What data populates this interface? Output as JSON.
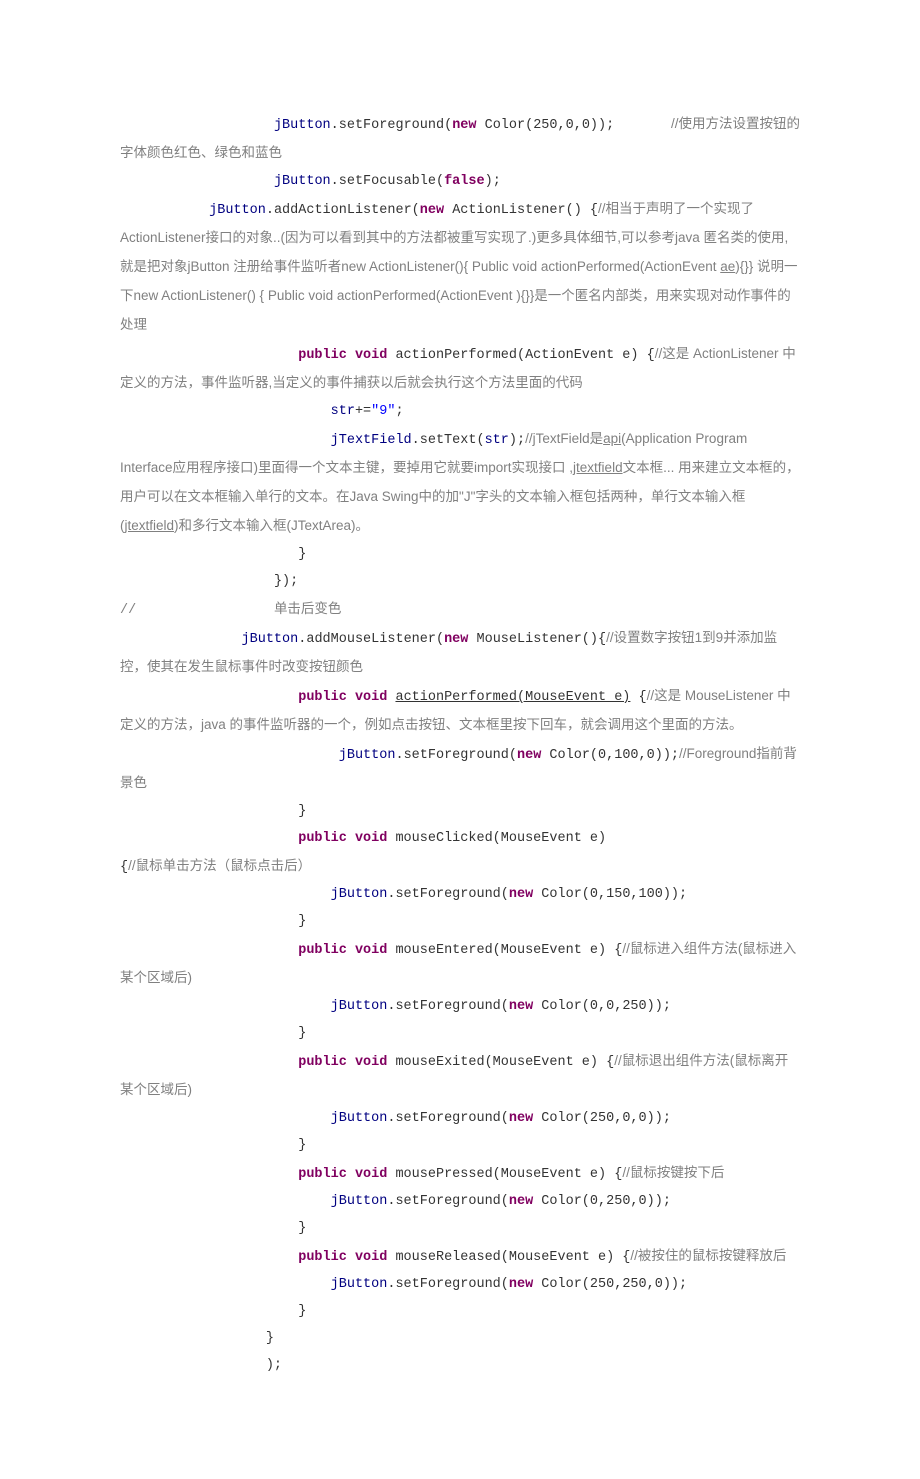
{
  "t": {
    "l1a": "jButton",
    "l1b": ".setForeground(",
    "l1c": "new",
    "l1d": " Color(250,0,0));",
    "l1e": "//使用方法设置按钮的字体颜色红色、绿色和蓝色",
    "l2a": "jButton",
    "l2b": ".setFocusable(",
    "l2c": "false",
    "l2d": ");",
    "l3a": "jButton",
    "l3b": ".addActionListener(",
    "l3c": "new",
    "l3d": " ActionListener() {",
    "l3e": "//相当于声明了一个实现了ActionListener接口的对象..(因为可以看到其中的方法都被重写实现了.)更多具体细节,可以参考java 匿名类的使用,就是把对象jButton 注册给事件监听者new ActionListener(){ Public void actionPerformed(ActionEvent ",
    "l3f": "ae",
    "l3g": "){}}   说明一下new ActionListener() { Public void actionPerformed(ActionEvent ){}}是一个匿名内部类，用来实现对动作事件的处理",
    "l4a": "public void",
    "l4b": " actionPerformed(ActionEvent e) {",
    "l4c": "//这是 ActionListener 中定义的方法，事件监听器,当定义的事件捕获以后就会执行这个方法里面的代码",
    "l5a": "str",
    "l5b": "+=",
    "l5c": "\"9\"",
    "l5d": ";",
    "l6a": "jTextField",
    "l6b": ".setText(",
    "l6c": "str",
    "l6d": ");",
    "l6e": "//jTextField是",
    "l6f": "api",
    "l6g": "(Application Program Interface应用程序接口)里面得一个文本主键，要掉用它就要import实现接口 ,",
    "l6h": "jtextfield",
    "l6i": "文本框... 用来建立文本框的，用户可以在文本框输入单行的文本。在Java Swing中的加\"J\"字头的文本输入框包括两种，单行文本输入框(",
    "l6j": "jtextfield",
    "l6k": ")和多行文本输入框(JTextArea)。",
    "l7": "}",
    "l8": "});",
    "l9a": "//",
    "l9b": "单击后变色",
    "l10a": "jButton",
    "l10b": ".addMouseListener(",
    "l10c": "new",
    "l10d": " MouseListener(){",
    "l10e": "//设置数字按钮1到9并添加监控，使其在发生鼠标事件时改变按钮颜色",
    "l11a": "public void",
    "l11b": " ",
    "l11c": "actionPerformed(MouseEvent e)",
    "l11d": " {",
    "l11e": "//这是 MouseListener 中定义的方法，java 的事件监听器的一个，例如点击按钮、文本框里按下回车，就会调用这个里面的方法。",
    "l12a": "jButton",
    "l12b": ".setForeground(",
    "l12c": "new",
    "l12d": " Color(0,100,0));",
    "l12e": "//Foreground指前背景色",
    "l13": "}",
    "l14a": "public void",
    "l14b": " mouseClicked(MouseEvent e) {",
    "l14c": "//鼠标单击方法（鼠标点击后）",
    "l15a": "jButton",
    "l15b": ".setForeground(",
    "l15c": "new",
    "l15d": " Color(0,150,100));",
    "l16": "}",
    "l17a": "public void",
    "l17b": " mouseEntered(MouseEvent e) {",
    "l17c": "//鼠标进入组件方法(鼠标进入某个区域后)",
    "l18a": "jButton",
    "l18b": ".setForeground(",
    "l18c": "new",
    "l18d": " Color(0,0,250));",
    "l19": "}",
    "l20a": "public void",
    "l20b": " mouseExited(MouseEvent e) {",
    "l20c": "//鼠标退出组件方法(鼠标离开某个区域后)",
    "l21a": "jButton",
    "l21b": ".setForeground(",
    "l21c": "new",
    "l21d": " Color(250,0,0));",
    "l22": "}",
    "l23a": "public void",
    "l23b": " mousePressed(MouseEvent e) {",
    "l23c": "//鼠标按键按下后",
    "l24a": "jButton",
    "l24b": ".setForeground(",
    "l24c": "new",
    "l24d": " Color(0,250,0));",
    "l25": "}",
    "l26a": "public void",
    "l26b": " mouseReleased(MouseEvent e) {",
    "l26c": "//被按住的鼠标按键释放后",
    "l27a": "jButton",
    "l27b": ".setForeground(",
    "l27c": "new",
    "l27d": " Color(250,250,0));",
    "l28": "}",
    "l29": "}",
    "l30": ");"
  }
}
